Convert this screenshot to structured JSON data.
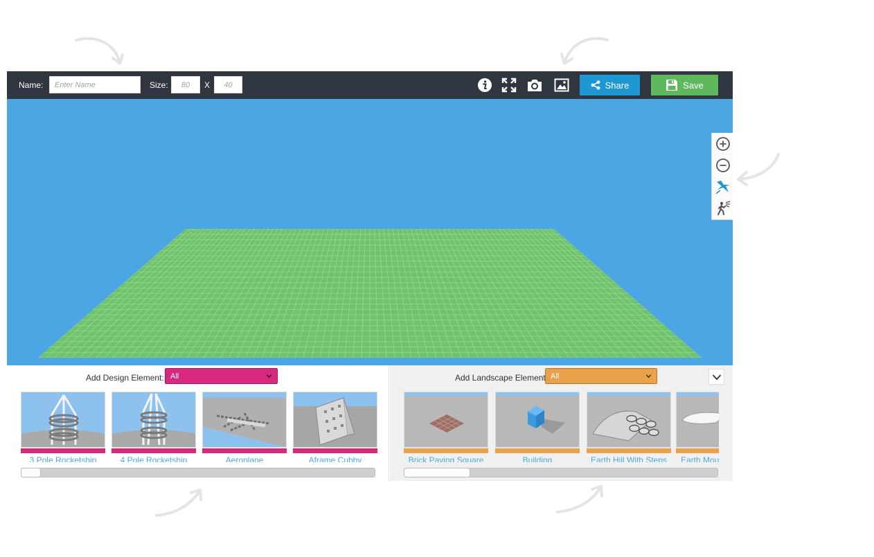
{
  "toolbar": {
    "name_label": "Name:",
    "name_placeholder": "Enter Name",
    "name_value": "",
    "size_label": "Size:",
    "width_placeholder": "80",
    "height_placeholder": "40",
    "size_separator": "X",
    "icons": [
      "info-icon",
      "fullscreen-icon",
      "camera-icon",
      "image-icon"
    ],
    "share_label": "Share",
    "save_label": "Save"
  },
  "side_tools": [
    "zoom-in-icon",
    "zoom-out-icon",
    "bird-view-icon",
    "walk-view-icon"
  ],
  "design_panel": {
    "label": "Add Design Element:",
    "filter_value": "All",
    "accent": "#d8297e",
    "items": [
      {
        "name": "3 Pole Rocketship"
      },
      {
        "name": "4 Pole Rocketship"
      },
      {
        "name": "Aeroplane"
      },
      {
        "name": "Aframe Cubby"
      }
    ],
    "scroll_position": 0.0
  },
  "landscape_panel": {
    "label": "Add Landscape Element:",
    "filter_value": "All",
    "accent": "#eaa24a",
    "items": [
      {
        "name": "Brick Paving Square"
      },
      {
        "name": "Building"
      },
      {
        "name": "Earth Hill With Steps"
      },
      {
        "name": "Earth Mou"
      }
    ],
    "scroll_position": 0.0
  },
  "colors": {
    "sky": "#4ba6e3",
    "ground": "#6fc36a",
    "toolbar": "#2f363f",
    "share": "#1e98d0",
    "save": "#5fb85d"
  }
}
